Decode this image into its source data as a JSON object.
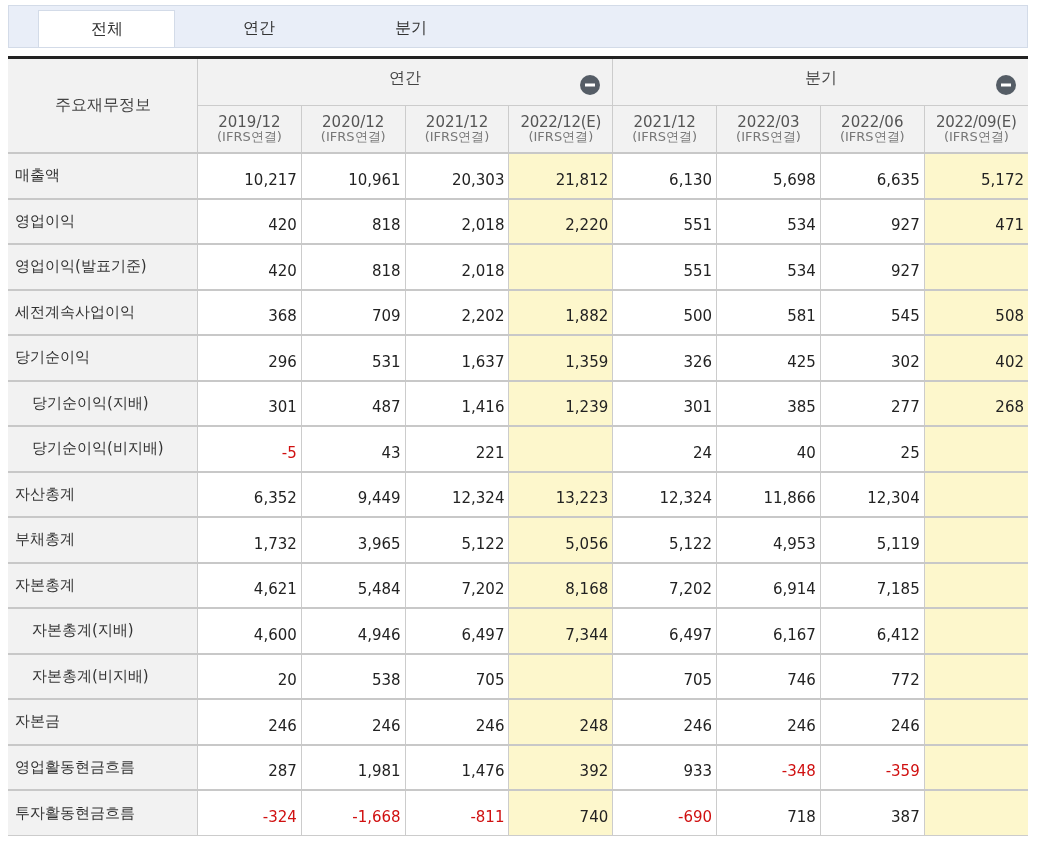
{
  "tabs": [
    {
      "label": "전체",
      "selected": true
    },
    {
      "label": "연간",
      "selected": false
    },
    {
      "label": "분기",
      "selected": false
    }
  ],
  "table": {
    "corner": "주요재무정보",
    "groups": [
      {
        "label": "연간",
        "collapsible": true,
        "columns": [
          {
            "period": "2019/12",
            "basis": "(IFRS연결)",
            "estimate": false
          },
          {
            "period": "2020/12",
            "basis": "(IFRS연결)",
            "estimate": false
          },
          {
            "period": "2021/12",
            "basis": "(IFRS연결)",
            "estimate": false
          },
          {
            "period": "2022/12(E)",
            "basis": "(IFRS연결)",
            "estimate": true
          }
        ]
      },
      {
        "label": "분기",
        "collapsible": true,
        "columns": [
          {
            "period": "2021/12",
            "basis": "(IFRS연결)",
            "estimate": false
          },
          {
            "period": "2022/03",
            "basis": "(IFRS연결)",
            "estimate": false
          },
          {
            "period": "2022/06",
            "basis": "(IFRS연결)",
            "estimate": false
          },
          {
            "period": "2022/09(E)",
            "basis": "(IFRS연결)",
            "estimate": true
          }
        ]
      }
    ],
    "rows": [
      {
        "label": "매출액",
        "values": [
          [
            "10,217",
            "10,961",
            "20,303",
            "21,812"
          ],
          [
            "6,130",
            "5,698",
            "6,635",
            "5,172"
          ]
        ]
      },
      {
        "label": "영업이익",
        "values": [
          [
            "420",
            "818",
            "2,018",
            "2,220"
          ],
          [
            "551",
            "534",
            "927",
            "471"
          ]
        ]
      },
      {
        "label": "영업이익(발표기준)",
        "values": [
          [
            "420",
            "818",
            "2,018"
          ],
          [
            "551",
            "534",
            "927"
          ]
        ]
      },
      {
        "label": "세전계속사업이익",
        "values": [
          [
            "368",
            "709",
            "2,202",
            "1,882"
          ],
          [
            "500",
            "581",
            "545",
            "508"
          ]
        ]
      },
      {
        "label": "당기순이익",
        "values": [
          [
            "296",
            "531",
            "1,637",
            "1,359"
          ],
          [
            "326",
            "425",
            "302",
            "402"
          ]
        ],
        "children": [
          {
            "label": "당기순이익(지배)",
            "values": [
              [
                "301",
                "487",
                "1,416",
                "1,239"
              ],
              [
                "301",
                "385",
                "277",
                "268"
              ]
            ]
          },
          {
            "label": "당기순이익(비지배)",
            "values": [
              [
                "-5",
                "43",
                "221"
              ],
              [
                "24",
                "40",
                "25"
              ]
            ]
          }
        ]
      },
      {
        "label": "자산총계",
        "values": [
          [
            "6,352",
            "9,449",
            "12,324",
            "13,223"
          ],
          [
            "12,324",
            "11,866",
            "12,304"
          ]
        ]
      },
      {
        "label": "부채총계",
        "values": [
          [
            "1,732",
            "3,965",
            "5,122",
            "5,056"
          ],
          [
            "5,122",
            "4,953",
            "5,119"
          ]
        ]
      },
      {
        "label": "자본총계",
        "values": [
          [
            "4,621",
            "5,484",
            "7,202",
            "8,168"
          ],
          [
            "7,202",
            "6,914",
            "7,185"
          ]
        ],
        "children": [
          {
            "label": "자본총계(지배)",
            "values": [
              [
                "4,600",
                "4,946",
                "6,497",
                "7,344"
              ],
              [
                "6,497",
                "6,167",
                "6,412"
              ]
            ]
          },
          {
            "label": "자본총계(비지배)",
            "values": [
              [
                "20",
                "538",
                "705"
              ],
              [
                "705",
                "746",
                "772"
              ]
            ]
          }
        ]
      },
      {
        "label": "자본금",
        "values": [
          [
            "246",
            "246",
            "246",
            "248"
          ],
          [
            "246",
            "246",
            "246"
          ]
        ]
      },
      {
        "label": "영업활동현금흐름",
        "values": [
          [
            "287",
            "1,981",
            "1,476",
            "392"
          ],
          [
            "933",
            "-348",
            "-359"
          ]
        ]
      },
      {
        "label": "투자활동현금흐름",
        "values": [
          [
            "-324",
            "-1,668",
            "-811",
            "740"
          ],
          [
            "-690",
            "718",
            "387"
          ]
        ]
      }
    ]
  }
}
